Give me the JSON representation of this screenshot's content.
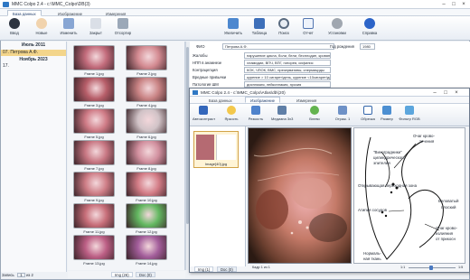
{
  "title": "MMC Colpo 2.4 - c:\\MMC_Colpo\\DB(3)",
  "window_controls": [
    "–",
    "□",
    "×"
  ],
  "tabs": [
    {
      "label": "База данных",
      "active": true
    },
    {
      "label": "Изображение",
      "active": false
    },
    {
      "label": "Измерения",
      "active": false
    }
  ],
  "toolbar": {
    "items": [
      {
        "label": "Ввод",
        "icon": "camera-icon"
      },
      {
        "label": "Новые",
        "icon": "user-icon"
      },
      {
        "label": "Изменить",
        "icon": "edit-icon"
      },
      {
        "label": "Закрыт",
        "icon": "lock-icon"
      },
      {
        "label": "Отсортир",
        "icon": "sort-icon"
      },
      {
        "label": "Увеличить",
        "icon": "zoom-fit-icon"
      },
      {
        "label": "Таблица",
        "icon": "table-icon"
      },
      {
        "label": "Поиск",
        "icon": "search-icon"
      },
      {
        "label": "Отчет",
        "icon": "report-icon"
      },
      {
        "label": "Установки",
        "icon": "gear-icon"
      },
      {
        "label": "Справка",
        "icon": "help-icon"
      }
    ],
    "filter_value": "Все записи"
  },
  "tree": {
    "items": [
      {
        "text": "Июль 2011",
        "type": "group"
      },
      {
        "text": "07.  Петрова А.Ф.",
        "type": "selected"
      },
      {
        "text": "Ноябрь 2023",
        "type": "group"
      },
      {
        "text": "17.",
        "type": "item"
      }
    ],
    "footer": {
      "label": "Запись",
      "current": "1",
      "of_label": "из",
      "total": "2"
    }
  },
  "thumbs": [
    {
      "caption": "Frame 1.jpg",
      "color": "#c36c7c"
    },
    {
      "caption": "Frame 2.jpg",
      "color": "#d38a91"
    },
    {
      "caption": "Frame 3.jpg",
      "color": "#b75e69"
    },
    {
      "caption": "Frame 4.jpg",
      "color": "#c98384"
    },
    {
      "caption": "Frame 5.jpg",
      "color": "#cf7b86"
    },
    {
      "caption": "Frame 6.jpg",
      "color": "#d1c3c7"
    },
    {
      "caption": "Frame 7.jpg",
      "color": "#c87783"
    },
    {
      "caption": "Frame 8.jpg",
      "color": "#d18f9e"
    },
    {
      "caption": "Frame 9.jpg",
      "color": "#ce7d86"
    },
    {
      "caption": "Frame 10.jpg",
      "color": "#d37c86"
    },
    {
      "caption": "Frame 11.jpg",
      "color": "#c76e79"
    },
    {
      "caption": "Frame 12.jpg",
      "color": "#63b861"
    },
    {
      "caption": "Frame 13.jpg",
      "color": "#bc5f85"
    },
    {
      "caption": "Frame 14.jpg",
      "color": "#a35e9b"
    }
  ],
  "thumb_tabs": [
    {
      "label": "Img (26)",
      "active": true
    },
    {
      "label": "Doc (0)",
      "active": false
    }
  ],
  "form": {
    "fio_label": "ФИО",
    "fio_value": "Петрова А.Ф.",
    "year_label": "Год рождения",
    "year_value": "1980",
    "rows": [
      {
        "label": "Жалобы",
        "value": "нарушение цикла, боли, бели, бесплодие, кровянистые"
      },
      {
        "label": "НПП в анамнезе",
        "value": "хламидии, ВПЧ, ВПГ, гонорея, сифилис"
      },
      {
        "label": "Контрацепция",
        "value": "КОК, ЧПОК, ВМС, презервативы, спермициды"
      },
      {
        "label": "Вредные привычки",
        "value": "курение > 10 сигарет/день, курение <10сигарет/день, алкоголь"
      },
      {
        "label": "Патология ШМ",
        "value": "дисплазия, лейкоплакия, эрозия"
      }
    ]
  },
  "dialog": {
    "title": "MMC Colpo 2.4 - c:\\MMC_Colpo\\Atlas\\db\\(20)",
    "tabs": [
      {
        "label": "База данных",
        "active": false
      },
      {
        "label": "Изображение",
        "active": true
      },
      {
        "label": "Измерения",
        "active": false
      }
    ],
    "tools": [
      {
        "label": "Автоконтраст",
        "icon": "star-icon"
      },
      {
        "label": "Яркость",
        "icon": "brightness-icon"
      },
      {
        "label": "Резкость",
        "icon": "sharpen-icon"
      },
      {
        "label": "Медиана 3x3",
        "icon": "median-icon"
      },
      {
        "label": "Влево",
        "icon": "arrow-left-icon"
      },
      {
        "label": "Отраж. 1",
        "icon": "mirror-icon"
      },
      {
        "label": "Обрезка",
        "icon": "crop-icon"
      },
      {
        "label": "Размер",
        "icon": "resize-icon"
      },
      {
        "label": "Фильтр RGB",
        "icon": "rgb-filter-icon"
      }
    ],
    "thumb_caption": "Image[40].jpg",
    "thumb_tabs": [
      {
        "label": "Img (1)",
        "active": true
      },
      {
        "label": "Doc (0)",
        "active": false
      }
    ],
    "status": "Кадр 1 из 1",
    "zoom_label": "1:1",
    "zoom_end": "1:5",
    "diagram_labels": [
      "Очаг крово-",
      "течения",
      "\"Виноградники\"",
      "цилиндрического",
      "эпителия",
      "Открывающая переходная зона",
      "Атипия сосудов",
      "Беловатый",
      "плоский",
      "Очаг крово-",
      "излияния",
      "от прикосн",
      "Нормаль-",
      "ная ткань"
    ]
  }
}
